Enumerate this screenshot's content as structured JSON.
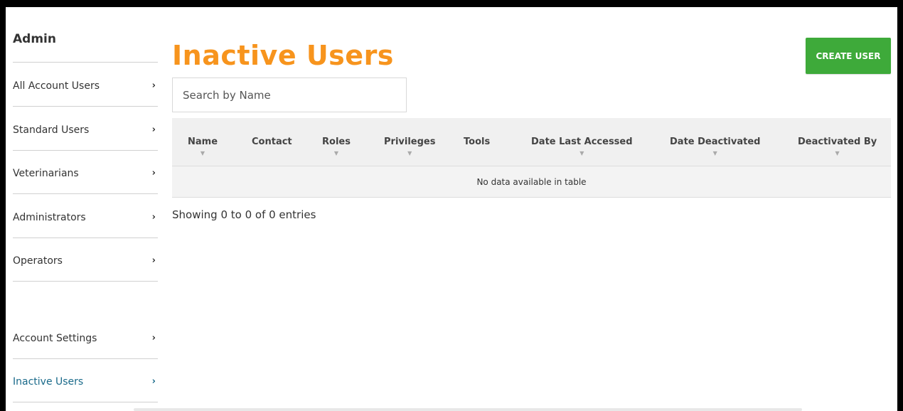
{
  "sidebar": {
    "title": "Admin",
    "items": [
      {
        "label": "All Account Users"
      },
      {
        "label": "Standard Users"
      },
      {
        "label": "Veterinarians"
      },
      {
        "label": "Administrators"
      },
      {
        "label": "Operators"
      },
      {
        "label": "Account Settings"
      },
      {
        "label": "Inactive Users",
        "active": true
      }
    ],
    "chevron": "›"
  },
  "main": {
    "title": "Inactive Users",
    "create_button": "CREATE USER",
    "search": {
      "placeholder": "Search by Name",
      "value": ""
    },
    "table": {
      "columns": [
        {
          "label": "Name",
          "sortable": true
        },
        {
          "label": "Contact",
          "sortable": false
        },
        {
          "label": "Roles",
          "sortable": true
        },
        {
          "label": "Privileges",
          "sortable": true
        },
        {
          "label": "Tools",
          "sortable": false
        },
        {
          "label": "Date Last Accessed",
          "sortable": true
        },
        {
          "label": "Date Deactivated",
          "sortable": true
        },
        {
          "label": "Deactivated By",
          "sortable": true
        }
      ],
      "sort_glyph": "▼",
      "empty_message": "No data available in table"
    },
    "info": "Showing 0 to 0 of 0 entries"
  },
  "colors": {
    "title": "#f7941d",
    "button": "#3eaa3a",
    "active_link": "#1a6a8a"
  }
}
